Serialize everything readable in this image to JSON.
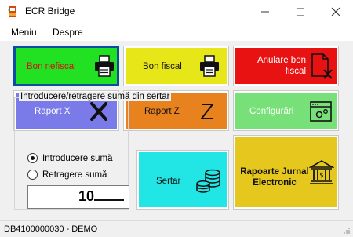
{
  "window": {
    "title": "ECR Bridge",
    "app_icon": "app-logo-icon",
    "controls": [
      "minimize-icon",
      "maximize-icon",
      "close-icon"
    ]
  },
  "menu": [
    "Meniu",
    "Despre"
  ],
  "tiles": {
    "bon_nefiscal": {
      "label": "Bon nefiscal",
      "color": "#22e022",
      "icon": "printer-icon",
      "selected": true
    },
    "bon_fiscal": {
      "label": "Bon fiscal",
      "color": "#e6e619",
      "icon": "printer-icon"
    },
    "anulare": {
      "label": "Anulare bon fiscal",
      "color": "#e81212",
      "icon": "cancel-document-icon"
    },
    "raport_x": {
      "label": "Raport X",
      "color": "#7a7ae8",
      "icon": "letter-x-icon"
    },
    "raport_z": {
      "label": "Raport Z",
      "color": "#e8821e",
      "icon": "letter-z-icon"
    },
    "configurari": {
      "label": "Configurări",
      "color": "#78e078",
      "icon": "settings-window-icon"
    },
    "sertar": {
      "label": "Sertar",
      "color": "#22e6e6",
      "icon": "coins-icon"
    },
    "rapoarte_jurnal": {
      "label": "Rapoarte Jurnal Electronic",
      "color": "#e6c71e",
      "icon": "bank-icon"
    }
  },
  "cash_group": {
    "title": "Introducere/retragere sumă din sertar",
    "options": [
      {
        "label": "Introducere sumă",
        "checked": true
      },
      {
        "label": "Retragere sumă",
        "checked": false
      }
    ],
    "amount": "10"
  },
  "status": {
    "text": "DB4100000030  -  DEMO"
  }
}
